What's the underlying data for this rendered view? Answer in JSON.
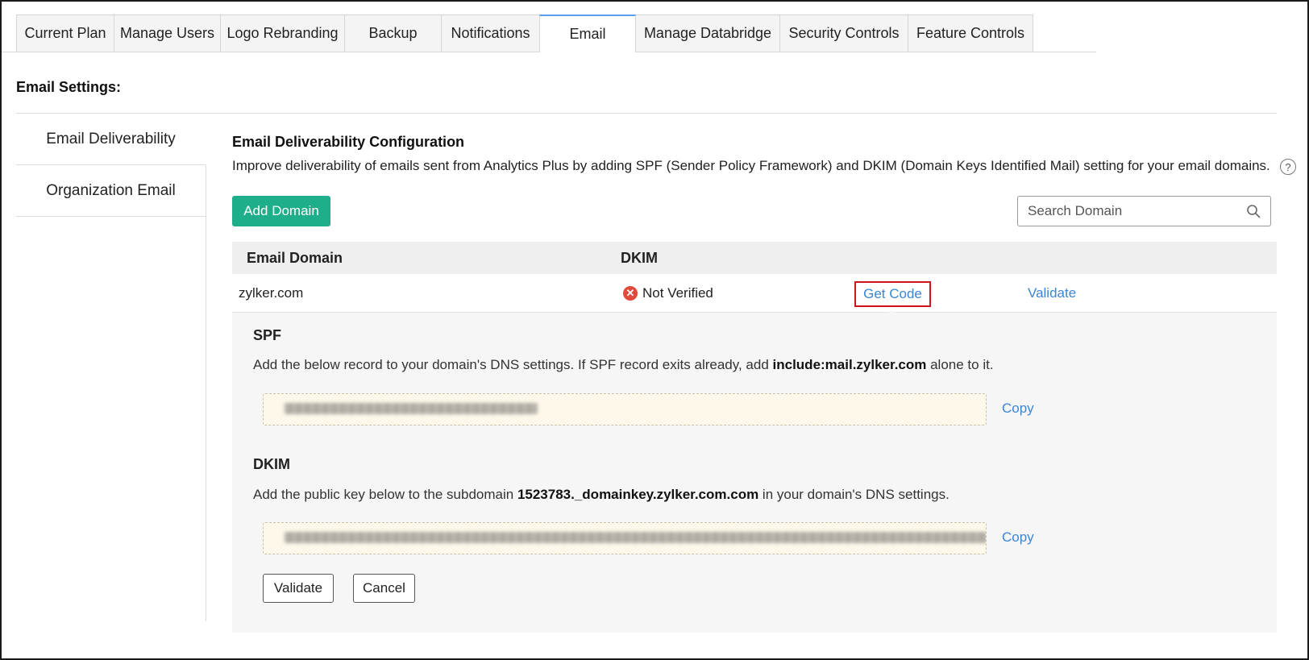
{
  "tabs": [
    {
      "label": "Current Plan",
      "width": 122
    },
    {
      "label": "Manage Users",
      "width": 133
    },
    {
      "label": "Logo Rebranding",
      "width": 155
    },
    {
      "label": "Backup",
      "width": 121
    },
    {
      "label": "Notifications",
      "width": 123
    },
    {
      "label": "Email",
      "width": 120,
      "active": true
    },
    {
      "label": "Manage Databridge",
      "width": 180
    },
    {
      "label": "Security Controls",
      "width": 160
    },
    {
      "label": "Feature Controls",
      "width": 156
    }
  ],
  "settings_title": "Email Settings:",
  "leftnav": {
    "items": [
      {
        "label": "Email Deliverability"
      },
      {
        "label": "Organization Email"
      }
    ]
  },
  "config": {
    "title": "Email Deliverability Configuration",
    "description": "Improve deliverability of emails sent from Analytics Plus by adding SPF (Sender Policy Framework) and DKIM (Domain Keys Identified Mail) setting for your email domains.",
    "help": "?"
  },
  "toolbar": {
    "add_domain_label": "Add Domain",
    "search_placeholder": "Search Domain"
  },
  "table": {
    "headers": {
      "domain": "Email Domain",
      "dkim": "DKIM"
    },
    "rows": [
      {
        "domain": "zylker.com",
        "status": "Not Verified",
        "get_code": "Get Code",
        "validate": "Validate"
      }
    ]
  },
  "panel": {
    "spf": {
      "title": "SPF",
      "desc_pre": "Add the below record to your domain's DNS settings. If SPF record exits already, add ",
      "desc_bold": "include:mail.zylker.com",
      "desc_post": " alone to it.",
      "copy_label": "Copy"
    },
    "dkim": {
      "title": "DKIM",
      "desc_pre": "Add the public key below to the subdomain ",
      "desc_bold": "1523783._domainkey.zylker.com.com",
      "desc_post": " in your domain's DNS settings.",
      "copy_label": "Copy"
    },
    "validate_label": "Validate",
    "cancel_label": "Cancel"
  },
  "colors": {
    "accent_green": "#1fae8a",
    "link_blue": "#3a86d6",
    "error_red": "#e04a3a",
    "highlight_red": "#d0101a"
  }
}
